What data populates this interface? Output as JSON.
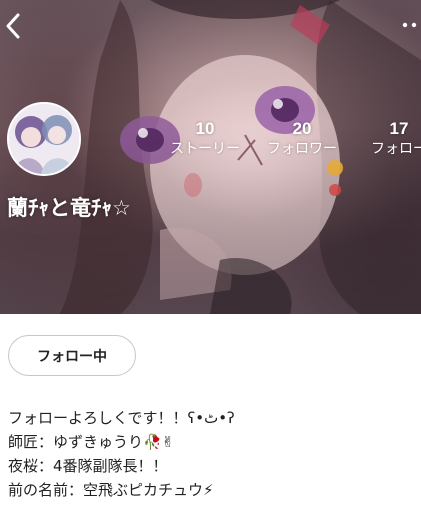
{
  "profile": {
    "username": "蘭ﾁｬと竜ﾁｬ☆",
    "stats": [
      {
        "value": "10",
        "label": "ストーリー"
      },
      {
        "value": "20",
        "label": "フォロワー"
      },
      {
        "value": "17",
        "label": "フォロー"
      }
    ]
  },
  "actions": {
    "follow_label": "フォロー中"
  },
  "bio": {
    "lines": [
      "フォローよろしくです！！ʕ•ٹ•ʔ",
      "師匠：ゆずきゅうり🥀✌",
      "夜桜：4番隊副隊長！！",
      "前の名前：空飛ぶピカチュウ⚡"
    ]
  },
  "icons": {
    "back": "chevron-left-icon",
    "more": "more-dots-icon"
  }
}
